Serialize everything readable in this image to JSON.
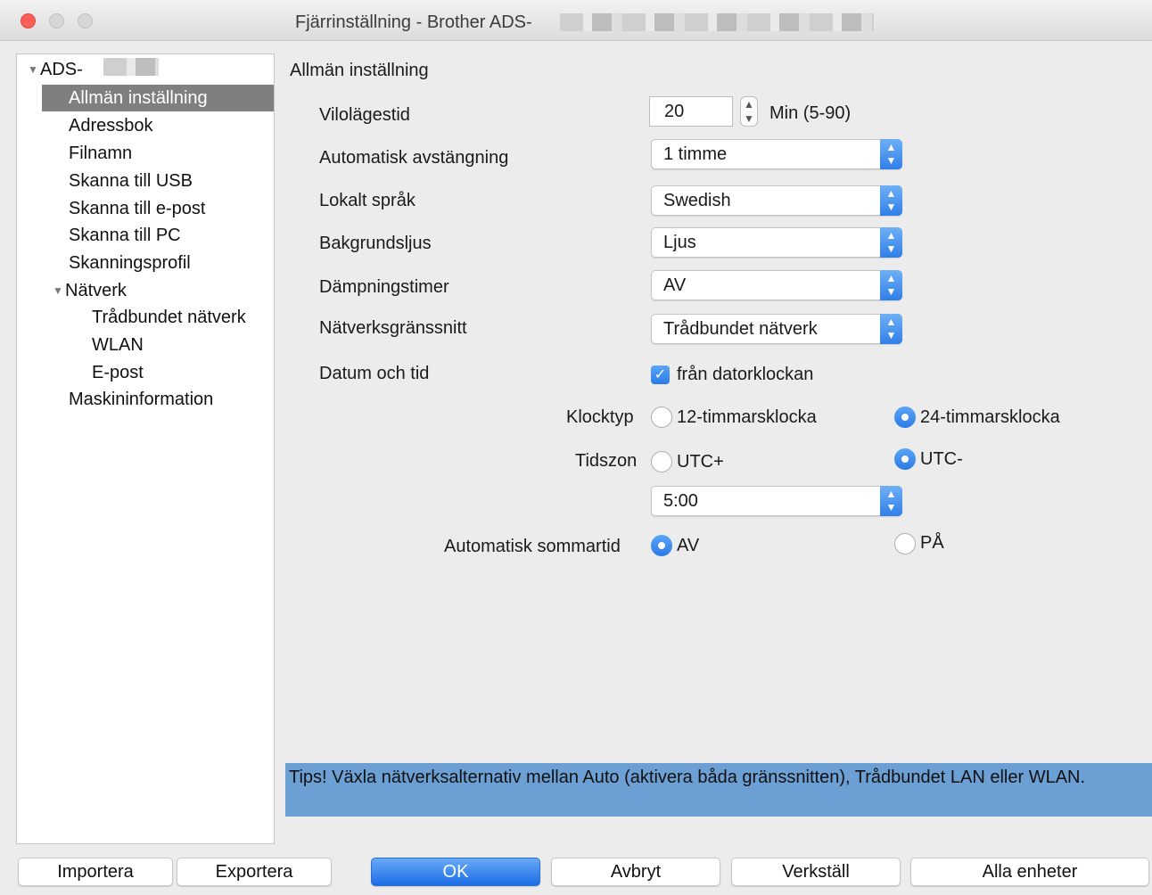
{
  "window": {
    "title": "Fjärrinställning - Brother ADS-"
  },
  "sidebar": {
    "root_label": "ADS-",
    "items": [
      {
        "label": "Allmän inställning",
        "selected": true
      },
      {
        "label": "Adressbok"
      },
      {
        "label": "Filnamn"
      },
      {
        "label": "Skanna till USB"
      },
      {
        "label": "Skanna till e-post"
      },
      {
        "label": "Skanna till PC"
      },
      {
        "label": "Skanningsprofil"
      },
      {
        "label": "Nätverk",
        "expanded": true
      },
      {
        "label": "Trådbundet nätverk"
      },
      {
        "label": "WLAN"
      },
      {
        "label": "E-post"
      },
      {
        "label": "Maskininformation"
      }
    ]
  },
  "main": {
    "section_title": "Allmän inställning",
    "sleep": {
      "label": "Vilolägestid",
      "value": "20",
      "unit": "Min (5-90)"
    },
    "auto_off": {
      "label": "Automatisk avstängning",
      "value": "1 timme"
    },
    "language": {
      "label": "Lokalt språk",
      "value": "Swedish"
    },
    "backlight": {
      "label": "Bakgrundsljus",
      "value": "Ljus"
    },
    "dim_timer": {
      "label": "Dämpningstimer",
      "value": "AV"
    },
    "network_interface": {
      "label": "Nätverksgränssnitt",
      "value": "Trådbundet nätverk"
    },
    "datetime": {
      "label": "Datum och tid",
      "checkbox_label": "från datorklockan",
      "checked": true
    },
    "clock_type": {
      "label": "Klocktyp",
      "option_12": "12-timmarsklocka",
      "option_24": "24-timmarsklocka",
      "selected": "24-timmarsklocka"
    },
    "timezone": {
      "label": "Tidszon",
      "option_plus": "UTC+",
      "option_minus": "UTC-",
      "selected": "UTC-",
      "offset": "5:00"
    },
    "dst": {
      "label": "Automatisk sommartid",
      "option_off": "AV",
      "option_on": "PÅ",
      "selected": "AV"
    }
  },
  "tips": "Tips! Växla nätverksalternativ mellan Auto (aktivera båda gränssnitten), Trådbundet LAN eller WLAN.",
  "footer": {
    "import": "Importera",
    "export": "Exportera",
    "ok": "OK",
    "cancel": "Avbryt",
    "apply": "Verkställ",
    "all_devices": "Alla enheter"
  },
  "colors": {
    "accent": "#2b7ae6",
    "tips_background": "#6c9fd3",
    "selected_item": "#7f7f7f",
    "close_button": "#fc5f57"
  }
}
